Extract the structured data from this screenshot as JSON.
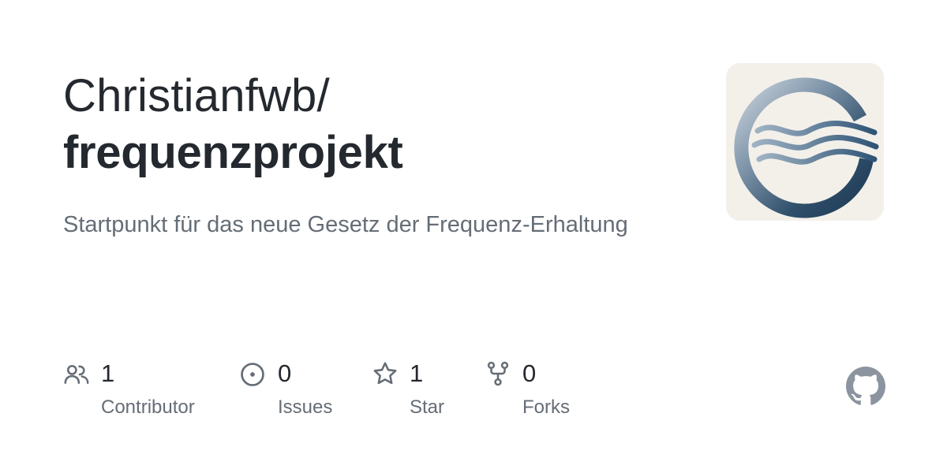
{
  "repo": {
    "owner": "Christianfwb/",
    "name": "frequenzprojekt",
    "description": "Startpunkt für das neue Gesetz der Frequenz-Erhaltung"
  },
  "avatar": {
    "icon": "wave-ring-logo-icon",
    "colors": {
      "background": "#f3f0ea",
      "ring": "#2f4f6b",
      "waves": "#3e6383"
    }
  },
  "stats": [
    {
      "icon": "people-icon",
      "count": "1",
      "label": "Contributor"
    },
    {
      "icon": "issue-circle-icon",
      "count": "0",
      "label": "Issues"
    },
    {
      "icon": "star-icon",
      "count": "1",
      "label": "Star"
    },
    {
      "icon": "fork-icon",
      "count": "0",
      "label": "Forks"
    }
  ],
  "footer": {
    "logo_icon": "github-icon",
    "logo_color": "#8c959f"
  },
  "colors": {
    "title": "#24292f",
    "secondary_text": "#656d76",
    "icon": "#656d76"
  }
}
